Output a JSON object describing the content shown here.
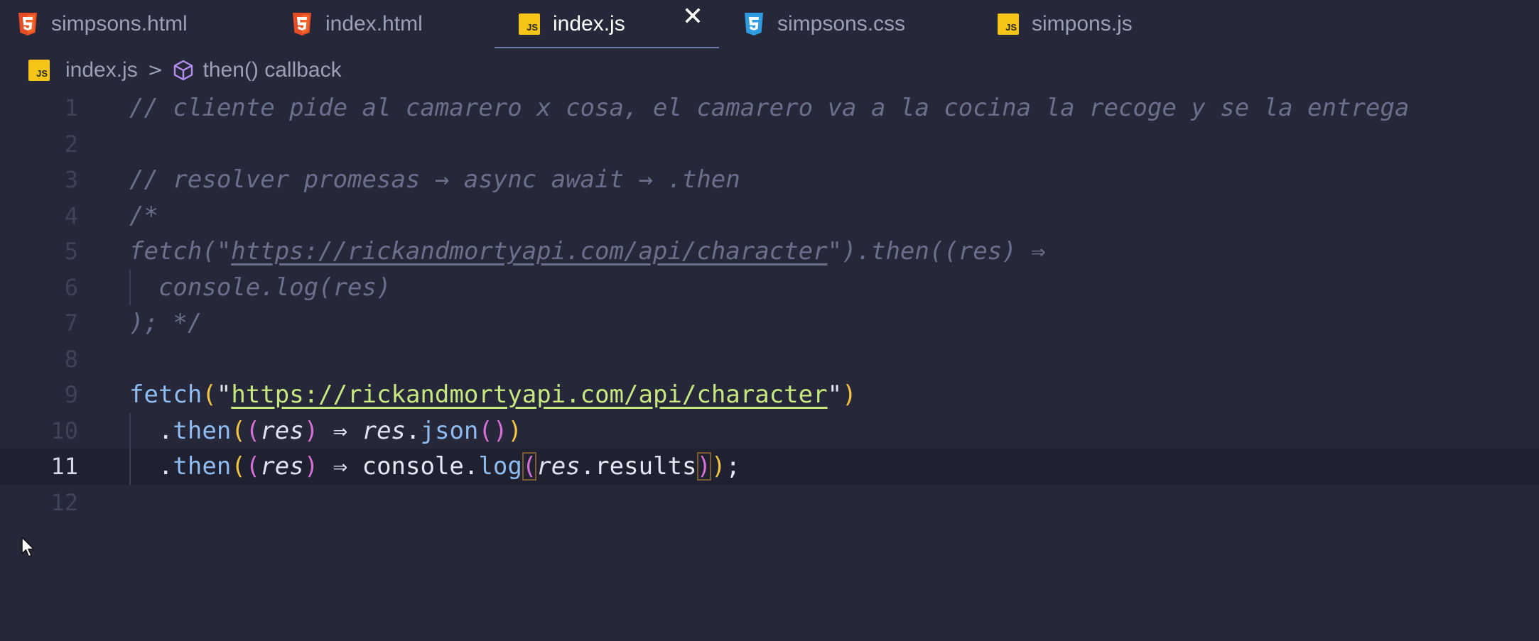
{
  "tabs": [
    {
      "label": "simpsons.html",
      "icon": "html5-icon",
      "active": false
    },
    {
      "label": "index.html",
      "icon": "html5-icon",
      "active": false
    },
    {
      "label": "index.js",
      "icon": "js-icon",
      "active": true,
      "close": "✕"
    },
    {
      "label": "simpsons.css",
      "icon": "css3-icon",
      "active": false
    },
    {
      "label": "simpons.js",
      "icon": "js-icon",
      "active": false
    }
  ],
  "js_icon_text": "JS",
  "breadcrumb": {
    "file": "index.js",
    "separator": ">",
    "symbol": "then() callback"
  },
  "code": {
    "current_line": 11,
    "lines": [
      {
        "n": "1",
        "parts": [
          [
            "// cliente pide al camarero x cosa, el camarero va a la cocina la recoge y se la entrega",
            "cmt"
          ]
        ]
      },
      {
        "n": "2",
        "parts": []
      },
      {
        "n": "3",
        "parts": [
          [
            "// resolver promesas → async await → .then",
            "cmt"
          ]
        ]
      },
      {
        "n": "4",
        "parts": [
          [
            "/*",
            "cmt"
          ]
        ]
      },
      {
        "n": "5",
        "parts": [
          [
            "fetch(\"",
            "cmt"
          ],
          [
            "https://rickandmortyapi.com/api/character",
            "cmt-url"
          ],
          [
            "\").then((res) ⇒",
            "cmt"
          ]
        ]
      },
      {
        "n": "6",
        "guide": true,
        "parts": [
          [
            "  console.log(res)",
            "cmt"
          ]
        ]
      },
      {
        "n": "7",
        "parts": [
          [
            "); */",
            "cmt"
          ]
        ]
      },
      {
        "n": "8",
        "parts": []
      },
      {
        "n": "9",
        "parts": [
          [
            "fetch",
            "fn"
          ],
          [
            "(",
            "p1"
          ],
          [
            "\"",
            "str"
          ],
          [
            "https://rickandmortyapi.com/api/character",
            "url"
          ],
          [
            "\"",
            "str"
          ],
          [
            ")",
            "p1"
          ]
        ]
      },
      {
        "n": "10",
        "guide": true,
        "parts": [
          [
            "  .",
            "plain"
          ],
          [
            "then",
            "fn"
          ],
          [
            "(",
            "p1"
          ],
          [
            "(",
            "p2"
          ],
          [
            "res",
            "param"
          ],
          [
            ")",
            "p2"
          ],
          [
            " ⇒ ",
            "op"
          ],
          [
            "res",
            "param"
          ],
          [
            ".",
            "plain"
          ],
          [
            "json",
            "fn"
          ],
          [
            "(",
            "p2"
          ],
          [
            ")",
            "p2"
          ],
          [
            ")",
            "p1"
          ]
        ]
      },
      {
        "n": "11",
        "guide": true,
        "parts": [
          [
            "  .",
            "plain"
          ],
          [
            "then",
            "fn"
          ],
          [
            "(",
            "p1"
          ],
          [
            "(",
            "p2"
          ],
          [
            "res",
            "param"
          ],
          [
            ")",
            "p2"
          ],
          [
            " ⇒ ",
            "op"
          ],
          [
            "console",
            "plain"
          ],
          [
            ".",
            "plain"
          ],
          [
            "log",
            "fn"
          ],
          [
            "(",
            "p2 bracket-box"
          ],
          [
            "res",
            "param"
          ],
          [
            ".",
            "plain"
          ],
          [
            "results",
            "plain"
          ],
          [
            ")",
            "p2 bracket-box"
          ],
          [
            ")",
            "p1"
          ],
          [
            ";",
            "plain"
          ]
        ]
      },
      {
        "n": "12",
        "parts": []
      }
    ]
  },
  "colors": {
    "background": "#262839",
    "current_line": "#1f2131",
    "js_badge": "#f5c518",
    "html_badge": "#e44d26",
    "css_badge": "#2f9be0",
    "url": "#c7e880",
    "comment": "#6a6f8c"
  }
}
